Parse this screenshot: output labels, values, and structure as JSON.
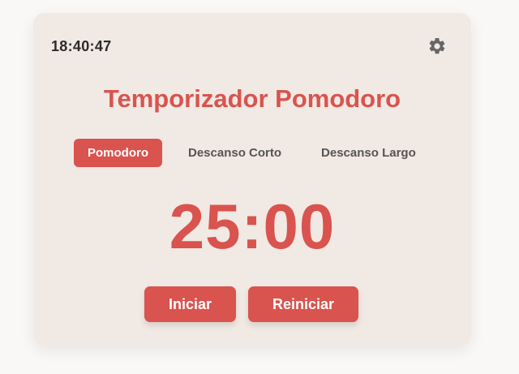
{
  "clock": {
    "time": "18:40:47"
  },
  "header": {
    "title": "Temporizador Pomodoro",
    "settings_icon": "gear-icon"
  },
  "tabs": [
    {
      "label": "Pomodoro",
      "active": true
    },
    {
      "label": "Descanso Corto",
      "active": false
    },
    {
      "label": "Descanso Largo",
      "active": false
    }
  ],
  "timer": {
    "display": "25:00"
  },
  "controls": {
    "start_label": "Iniciar",
    "reset_label": "Reiniciar"
  },
  "colors": {
    "accent": "#d9534f",
    "card_bg": "#f1e9e3",
    "page_bg": "#faf8f6",
    "icon": "#666666"
  }
}
